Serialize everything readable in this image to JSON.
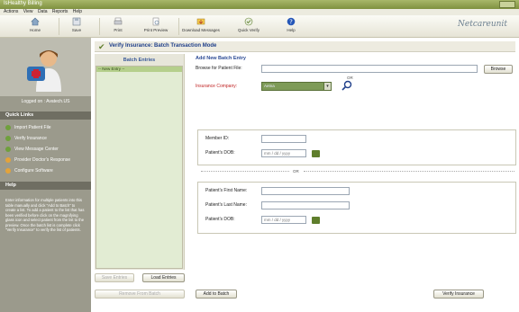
{
  "window": {
    "title": "IsHealthy Billing"
  },
  "menu": {
    "items": [
      "Actions",
      "View",
      "Data",
      "Reports",
      "Help"
    ]
  },
  "toolbar": {
    "buttons": [
      {
        "label": "Home",
        "icon": "home-icon"
      },
      {
        "label": "Save",
        "icon": "save-icon"
      },
      {
        "label": "Print",
        "icon": "print-icon"
      },
      {
        "label": "Print Preview",
        "icon": "print-preview-icon"
      },
      {
        "label": "Download Messages",
        "icon": "download-icon"
      },
      {
        "label": "Quick Verify",
        "icon": "quick-verify-icon"
      },
      {
        "label": "Help",
        "icon": "help-icon"
      }
    ],
    "logo": "Netcareunit"
  },
  "sidebar": {
    "logged_in": "Logged on : Avatech.US",
    "quick_links_title": "Quick Links",
    "quick_links": [
      {
        "label": "Import Patient File",
        "color": "#6fa03c"
      },
      {
        "label": "Verify Insurance",
        "color": "#6fa03c"
      },
      {
        "label": "View Message Center",
        "color": "#6fa03c"
      },
      {
        "label": "Provider Doctor's Response",
        "color": "#e3a33a"
      },
      {
        "label": "Configure Software",
        "color": "#e3a33a"
      }
    ],
    "help_title": "Help",
    "help_text": "Enter information for multiple patients into this table manually and click \"Add to Batch\" to create a list. To add a patient to the list that has been verified before click on the magnifying glass icon and select patient from the list to the preview. Once the batch list is complete click \"Verify Insurance\" to verify the list of patients."
  },
  "main": {
    "header": "Verify Insurance: Batch Transaction Mode",
    "batch_title": "Batch Entries",
    "batch_items": [
      "-- New Entry --"
    ],
    "form": {
      "title": "Add New Batch Entry",
      "browse_label": "Browse for Patient File:",
      "browse_button": "Browse",
      "or1": "OR",
      "insurance_label": "Insurance Company:",
      "insurance_value": "Aetna",
      "member_id_label": "Member ID:",
      "dob1_label": "Patient's DOB:",
      "dob1_placeholder": "mm / dd / yyyy",
      "or2": "OR",
      "first_name_label": "Patient's First Name:",
      "last_name_label": "Patient's Last Name:",
      "dob2_label": "Patient's DOB:",
      "dob2_placeholder": "mm / dd / yyyy"
    },
    "buttons": {
      "save_entries": "Save Entries",
      "load_entries": "Load Entries",
      "remove_from_batch": "Remove From Batch",
      "add_to_batch": "Add to Batch",
      "verify_insurance": "Verify Insurance"
    }
  }
}
